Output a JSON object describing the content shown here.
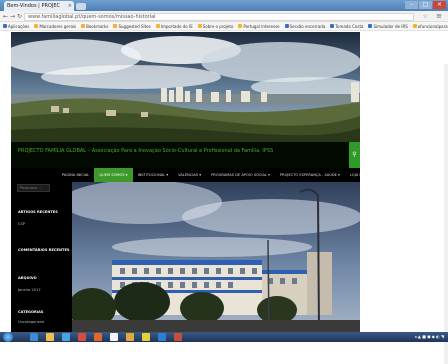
{
  "browser": {
    "tab_title": "Bem-Vindos | PROJEC",
    "tab_close": "×",
    "url": "www.familiaglobal.pt/quem-somos/missao-historial",
    "bookmarks": [
      {
        "label": "Aplicações",
        "icon": "apps-icon",
        "color": "#3c6fc4"
      },
      {
        "label": "Marcadores gerais",
        "icon": "folder-icon",
        "color": "#f0b431"
      },
      {
        "label": "Bookmarks",
        "icon": "star-icon",
        "color": "#f0b431"
      },
      {
        "label": "Suggested Sites",
        "icon": "folder-icon",
        "color": "#f0b431"
      },
      {
        "label": "Importado do IE",
        "icon": "folder-icon",
        "color": "#f0b431"
      },
      {
        "label": "Sobre o projeto",
        "icon": "folder-icon",
        "color": "#f0b431"
      },
      {
        "label": "Portugal Interesse",
        "icon": "folder-icon",
        "color": "#f0b431"
      },
      {
        "label": "Sessão encerrada",
        "icon": "page-icon",
        "color": "#3c6fc4"
      },
      {
        "label": "Tomada Costa",
        "icon": "page-icon",
        "color": "#3c6fc4"
      },
      {
        "label": "Simulador de IRS",
        "icon": "page-icon",
        "color": "#3c6fc4"
      },
      {
        "label": "ofuncionalparapsicologia",
        "icon": "folder-icon",
        "color": "#f0b431"
      },
      {
        "label": "Outros marcadores",
        "icon": "folder-icon",
        "color": "#f0b431"
      }
    ]
  },
  "site": {
    "title": "PROJECTO FAMÍLIA GLOBAL – Associação Para a Inovação Sócio-Cultural e Profissional da Família, IPSS",
    "nav": [
      {
        "label": "PÁGINA INICIAL",
        "active": false
      },
      {
        "label": "QUEM SOMOS ▾",
        "active": true
      },
      {
        "label": "INSTITUCIONAL ▾",
        "active": false
      },
      {
        "label": "VALÊNCIAS ▾",
        "active": false
      },
      {
        "label": "PROGRAMAS DE APOIO SOCIAL ▾",
        "active": false
      },
      {
        "label": "PROJECTO ESPERANÇA - SAÚDE ▾",
        "active": false
      },
      {
        "label": "LOJA SOLIDÁRIA",
        "active": false
      },
      {
        "label": "COMO AJUDAR ▾",
        "active": false
      },
      {
        "label": "FOTOS",
        "active": false
      }
    ],
    "search_placeholder": "Pesquisar …",
    "widgets": [
      {
        "title": "ARTIGOS RECENTES",
        "text": "CSP"
      },
      {
        "title": "COMENTÁRIOS RECENTES",
        "text": ""
      },
      {
        "title": "ARQUIVO",
        "text": "Janeiro 2017"
      },
      {
        "title": "CATEGORIAS",
        "text": "Uncategorized"
      }
    ]
  },
  "colors": {
    "accent_green": "#3d9a2a",
    "title_green": "#4caa2f",
    "site_bg": "#000000"
  },
  "taskbar": {
    "tray_text": "◂ ▲ ■ ◼ ◆ ◐ ◥"
  }
}
